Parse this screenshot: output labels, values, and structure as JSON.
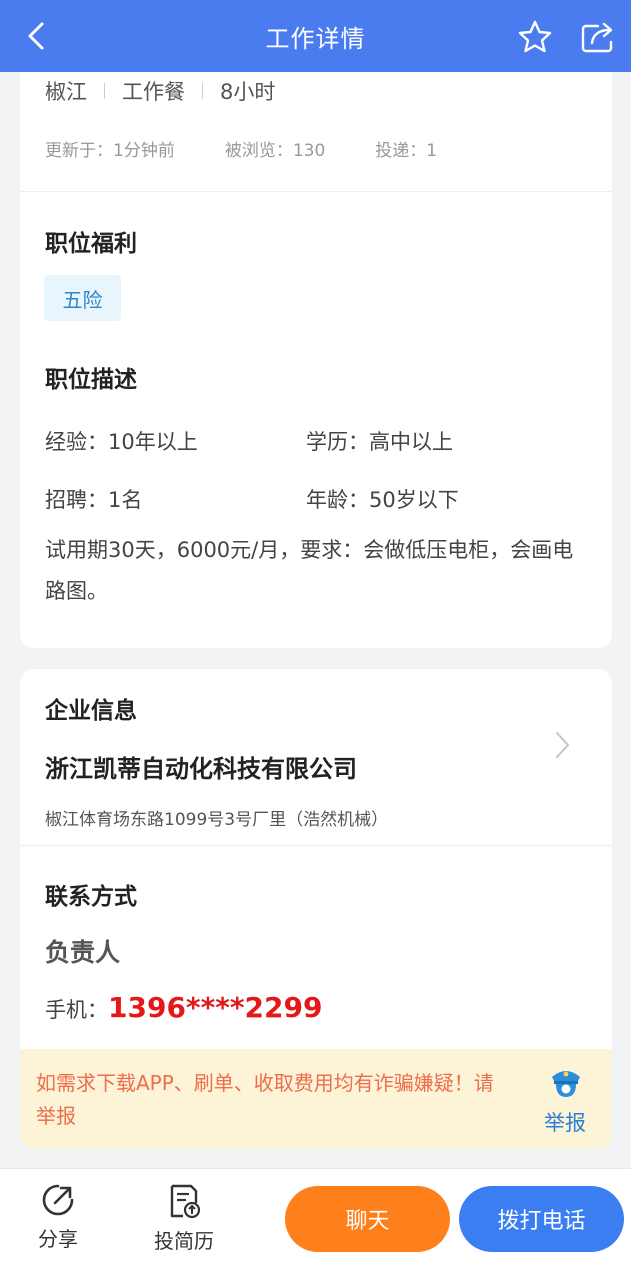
{
  "header": {
    "title": "工作详情"
  },
  "job": {
    "tags": [
      "椒江",
      "工作餐",
      "8小时"
    ],
    "meta": {
      "updated": "更新于：1分钟前",
      "views": "被浏览：130",
      "applies": "投递：1"
    }
  },
  "benefits": {
    "title": "职位福利",
    "tags": [
      "五险"
    ]
  },
  "description": {
    "title": "职位描述",
    "experience": "经验：10年以上",
    "education": "学历：高中以上",
    "recruit": "招聘：1名",
    "age": "年龄：50岁以下",
    "text": "试用期30天，6000元/月，要求：会做低压电柜，会画电路图。"
  },
  "company": {
    "title": "企业信息",
    "name": "浙江凯蒂自动化科技有限公司",
    "address": "椒江体育场东路1099号3号厂里（浩然机械）"
  },
  "contact": {
    "title": "联系方式",
    "person": "负责人",
    "phone_label": "手机：",
    "phone": "1396****2299"
  },
  "warning": {
    "text": "如需求下载APP、刷单、收取费用均有诈骗嫌疑！请举报",
    "report_label": "举报"
  },
  "bottom": {
    "share_label": "分享",
    "resume_label": "投简历",
    "chat_label": "聊天",
    "call_label": "拨打电话"
  },
  "colors": {
    "header": "#4a7cf0",
    "chat_button": "#ff7f1a",
    "call_button": "#3b7ef2",
    "phone": "#e61717",
    "warning_bg": "#fdf4d8",
    "warning_text": "#ee6d4c"
  }
}
